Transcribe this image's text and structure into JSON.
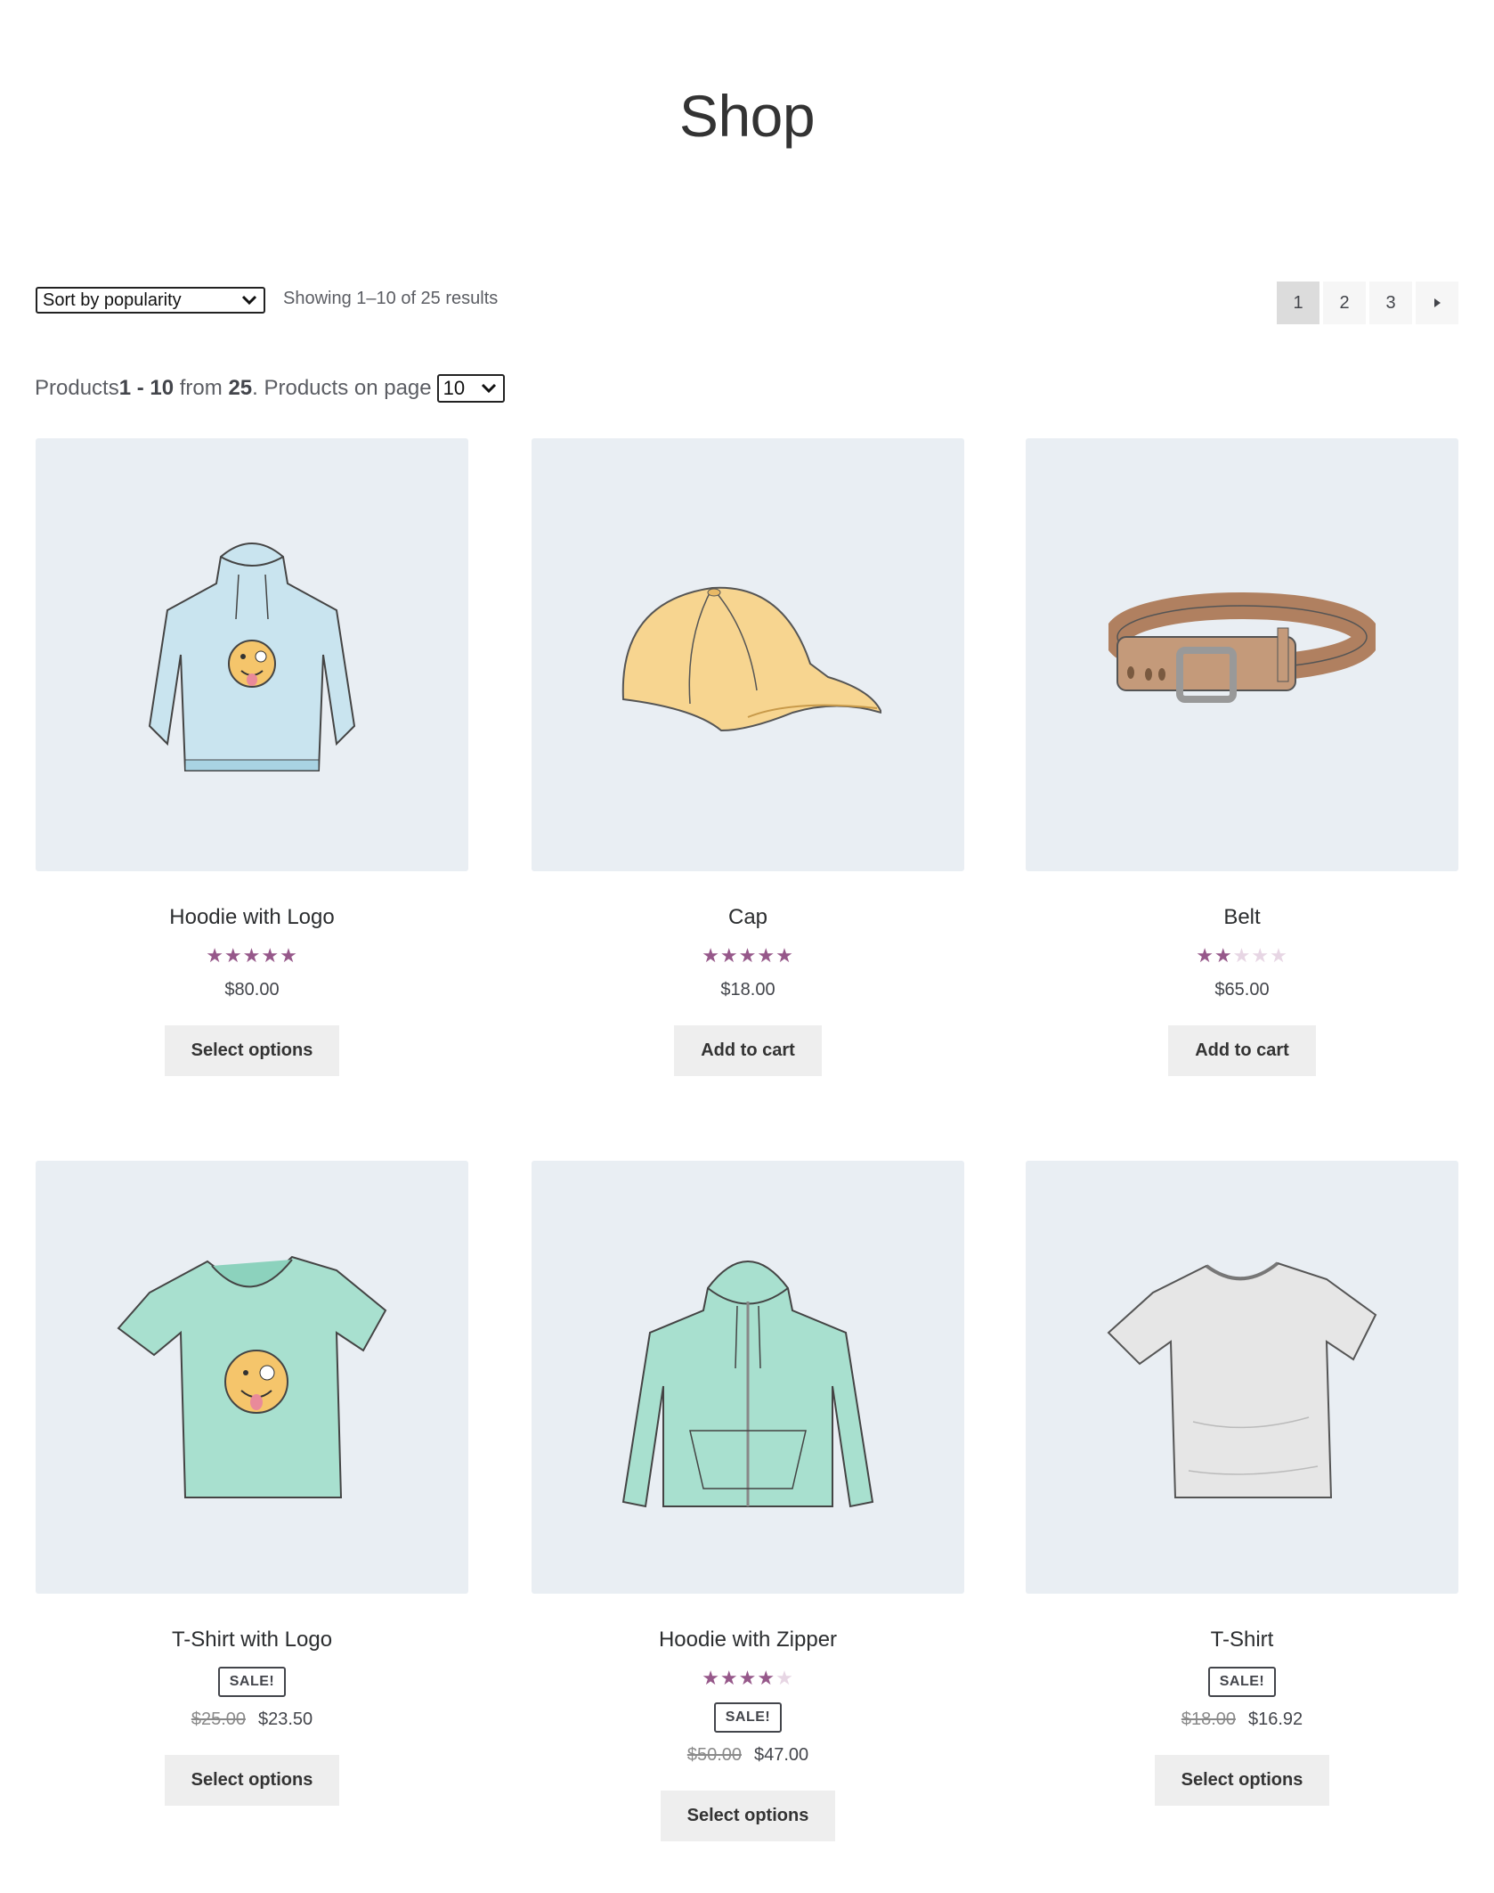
{
  "page_title": "Shop",
  "toolbar": {
    "sort_selected": "Sort by popularity",
    "result_count": "Showing 1–10 of 25 results",
    "pages": [
      "1",
      "2",
      "3"
    ],
    "current_page": "1"
  },
  "per_page": {
    "prefix": "Products ",
    "range": "1 - 10",
    "from_word": " from ",
    "total": "25",
    "suffix": ". Products on page",
    "selected": "10"
  },
  "products": [
    {
      "name": "Hoodie with Logo",
      "rating": 5,
      "price": "$80.00",
      "button": "Select options",
      "icon": "hoodie-logo-image"
    },
    {
      "name": "Cap",
      "rating": 5,
      "price": "$18.00",
      "button": "Add to cart",
      "icon": "cap-image"
    },
    {
      "name": "Belt",
      "rating": 2,
      "price": "$65.00",
      "button": "Add to cart",
      "icon": "belt-image"
    },
    {
      "name": "T-Shirt with Logo",
      "sale": "SALE!",
      "old_price": "$25.00",
      "price": "$23.50",
      "button": "Select options",
      "icon": "tshirt-logo-image"
    },
    {
      "name": "Hoodie with Zipper",
      "rating": 4,
      "sale": "SALE!",
      "old_price": "$50.00",
      "price": "$47.00",
      "button": "Select options",
      "icon": "hoodie-zipper-image"
    },
    {
      "name": "T-Shirt",
      "sale": "SALE!",
      "old_price": "$18.00",
      "price": "$16.92",
      "button": "Select options",
      "icon": "tshirt-image"
    }
  ],
  "colors": {
    "star": "#96588a",
    "star_empty": "#e7d6e4",
    "image_bg": "#e9eef3",
    "button_bg": "#eeeeee"
  }
}
